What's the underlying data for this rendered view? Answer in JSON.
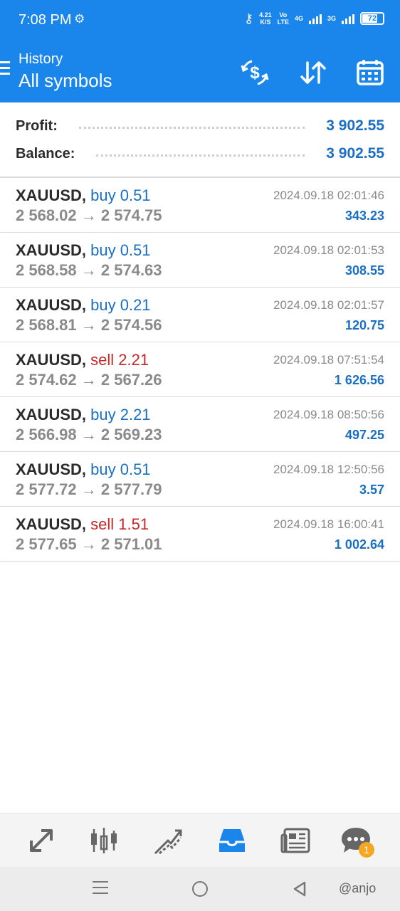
{
  "status_bar": {
    "time": "7:08 PM",
    "speed_value": "4.21",
    "speed_unit": "K/S",
    "volte_top": "Vo",
    "volte_bottom": "LTE",
    "net_type": "4G",
    "net_type2": "3G",
    "battery": "72"
  },
  "header": {
    "subtitle": "History",
    "title": "All symbols",
    "icons": [
      "currency-exchange-icon",
      "sort-icon",
      "calendar-icon"
    ]
  },
  "summary": {
    "profit_label": "Profit:",
    "profit_value": "3 902.55",
    "balance_label": "Balance:",
    "balance_value": "3 902.55"
  },
  "deals": [
    {
      "symbol": "XAUUSD,",
      "side": "buy",
      "side_text": "buy 0.51",
      "open": "2 568.02",
      "arrow": "→",
      "close": "2 574.75",
      "datetime": "2024.09.18 02:01:46",
      "profit": "343.23"
    },
    {
      "symbol": "XAUUSD,",
      "side": "buy",
      "side_text": "buy 0.51",
      "open": "2 568.58",
      "arrow": "→",
      "close": "2 574.63",
      "datetime": "2024.09.18 02:01:53",
      "profit": "308.55"
    },
    {
      "symbol": "XAUUSD,",
      "side": "buy",
      "side_text": "buy 0.21",
      "open": "2 568.81",
      "arrow": "→",
      "close": "2 574.56",
      "datetime": "2024.09.18 02:01:57",
      "profit": "120.75"
    },
    {
      "symbol": "XAUUSD,",
      "side": "sell",
      "side_text": "sell 2.21",
      "open": "2 574.62",
      "arrow": "→",
      "close": "2 567.26",
      "datetime": "2024.09.18 07:51:54",
      "profit": "1 626.56"
    },
    {
      "symbol": "XAUUSD,",
      "side": "buy",
      "side_text": "buy 2.21",
      "open": "2 566.98",
      "arrow": "→",
      "close": "2 569.23",
      "datetime": "2024.09.18 08:50:56",
      "profit": "497.25"
    },
    {
      "symbol": "XAUUSD,",
      "side": "buy",
      "side_text": "buy 0.51",
      "open": "2 577.72",
      "arrow": "→",
      "close": "2 577.79",
      "datetime": "2024.09.18 12:50:56",
      "profit": "3.57"
    },
    {
      "symbol": "XAUUSD,",
      "side": "sell",
      "side_text": "sell 1.51",
      "open": "2 577.65",
      "arrow": "→",
      "close": "2 571.01",
      "datetime": "2024.09.18 16:00:41",
      "profit": "1 002.64"
    }
  ],
  "bottom_nav": {
    "items": [
      "quotes-icon",
      "chart-icon",
      "trade-icon",
      "history-icon",
      "news-icon",
      "messages-icon"
    ],
    "active": "history-icon",
    "messages_badge": "1"
  },
  "watermark": "@anjo",
  "colors": {
    "accent": "#1a86ec",
    "buy": "#1b6fc2",
    "sell": "#c62828"
  }
}
